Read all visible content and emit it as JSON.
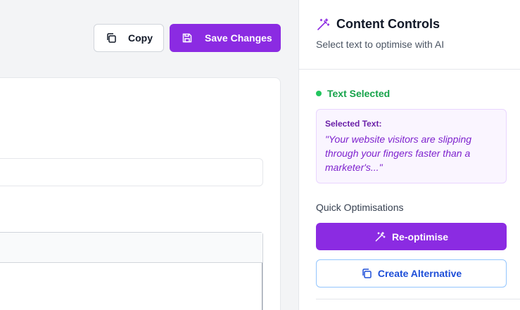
{
  "toolbar": {
    "copy_label": "Copy",
    "copy_icon": "copy-icon",
    "save_label": "Save Changes",
    "save_icon": "floppy-disk-icon"
  },
  "panel": {
    "title": "Content Controls",
    "title_icon": "magic-wand-icon",
    "subtitle": "Select text to optimise with AI",
    "status": "Text Selected",
    "selected_label": "Selected Text:",
    "selected_text": "\"Your website visitors are slipping through your fingers faster than a marketer's...\"",
    "section_label": "Quick Optimisations",
    "reoptimise_label": "Re-optimise",
    "reoptimise_icon": "magic-wand-icon",
    "alternative_label": "Create Alternative",
    "alternative_icon": "copy-icon"
  },
  "colors": {
    "accent": "#8b2be2",
    "success": "#16a34a",
    "link_blue": "#1d4ed8"
  }
}
